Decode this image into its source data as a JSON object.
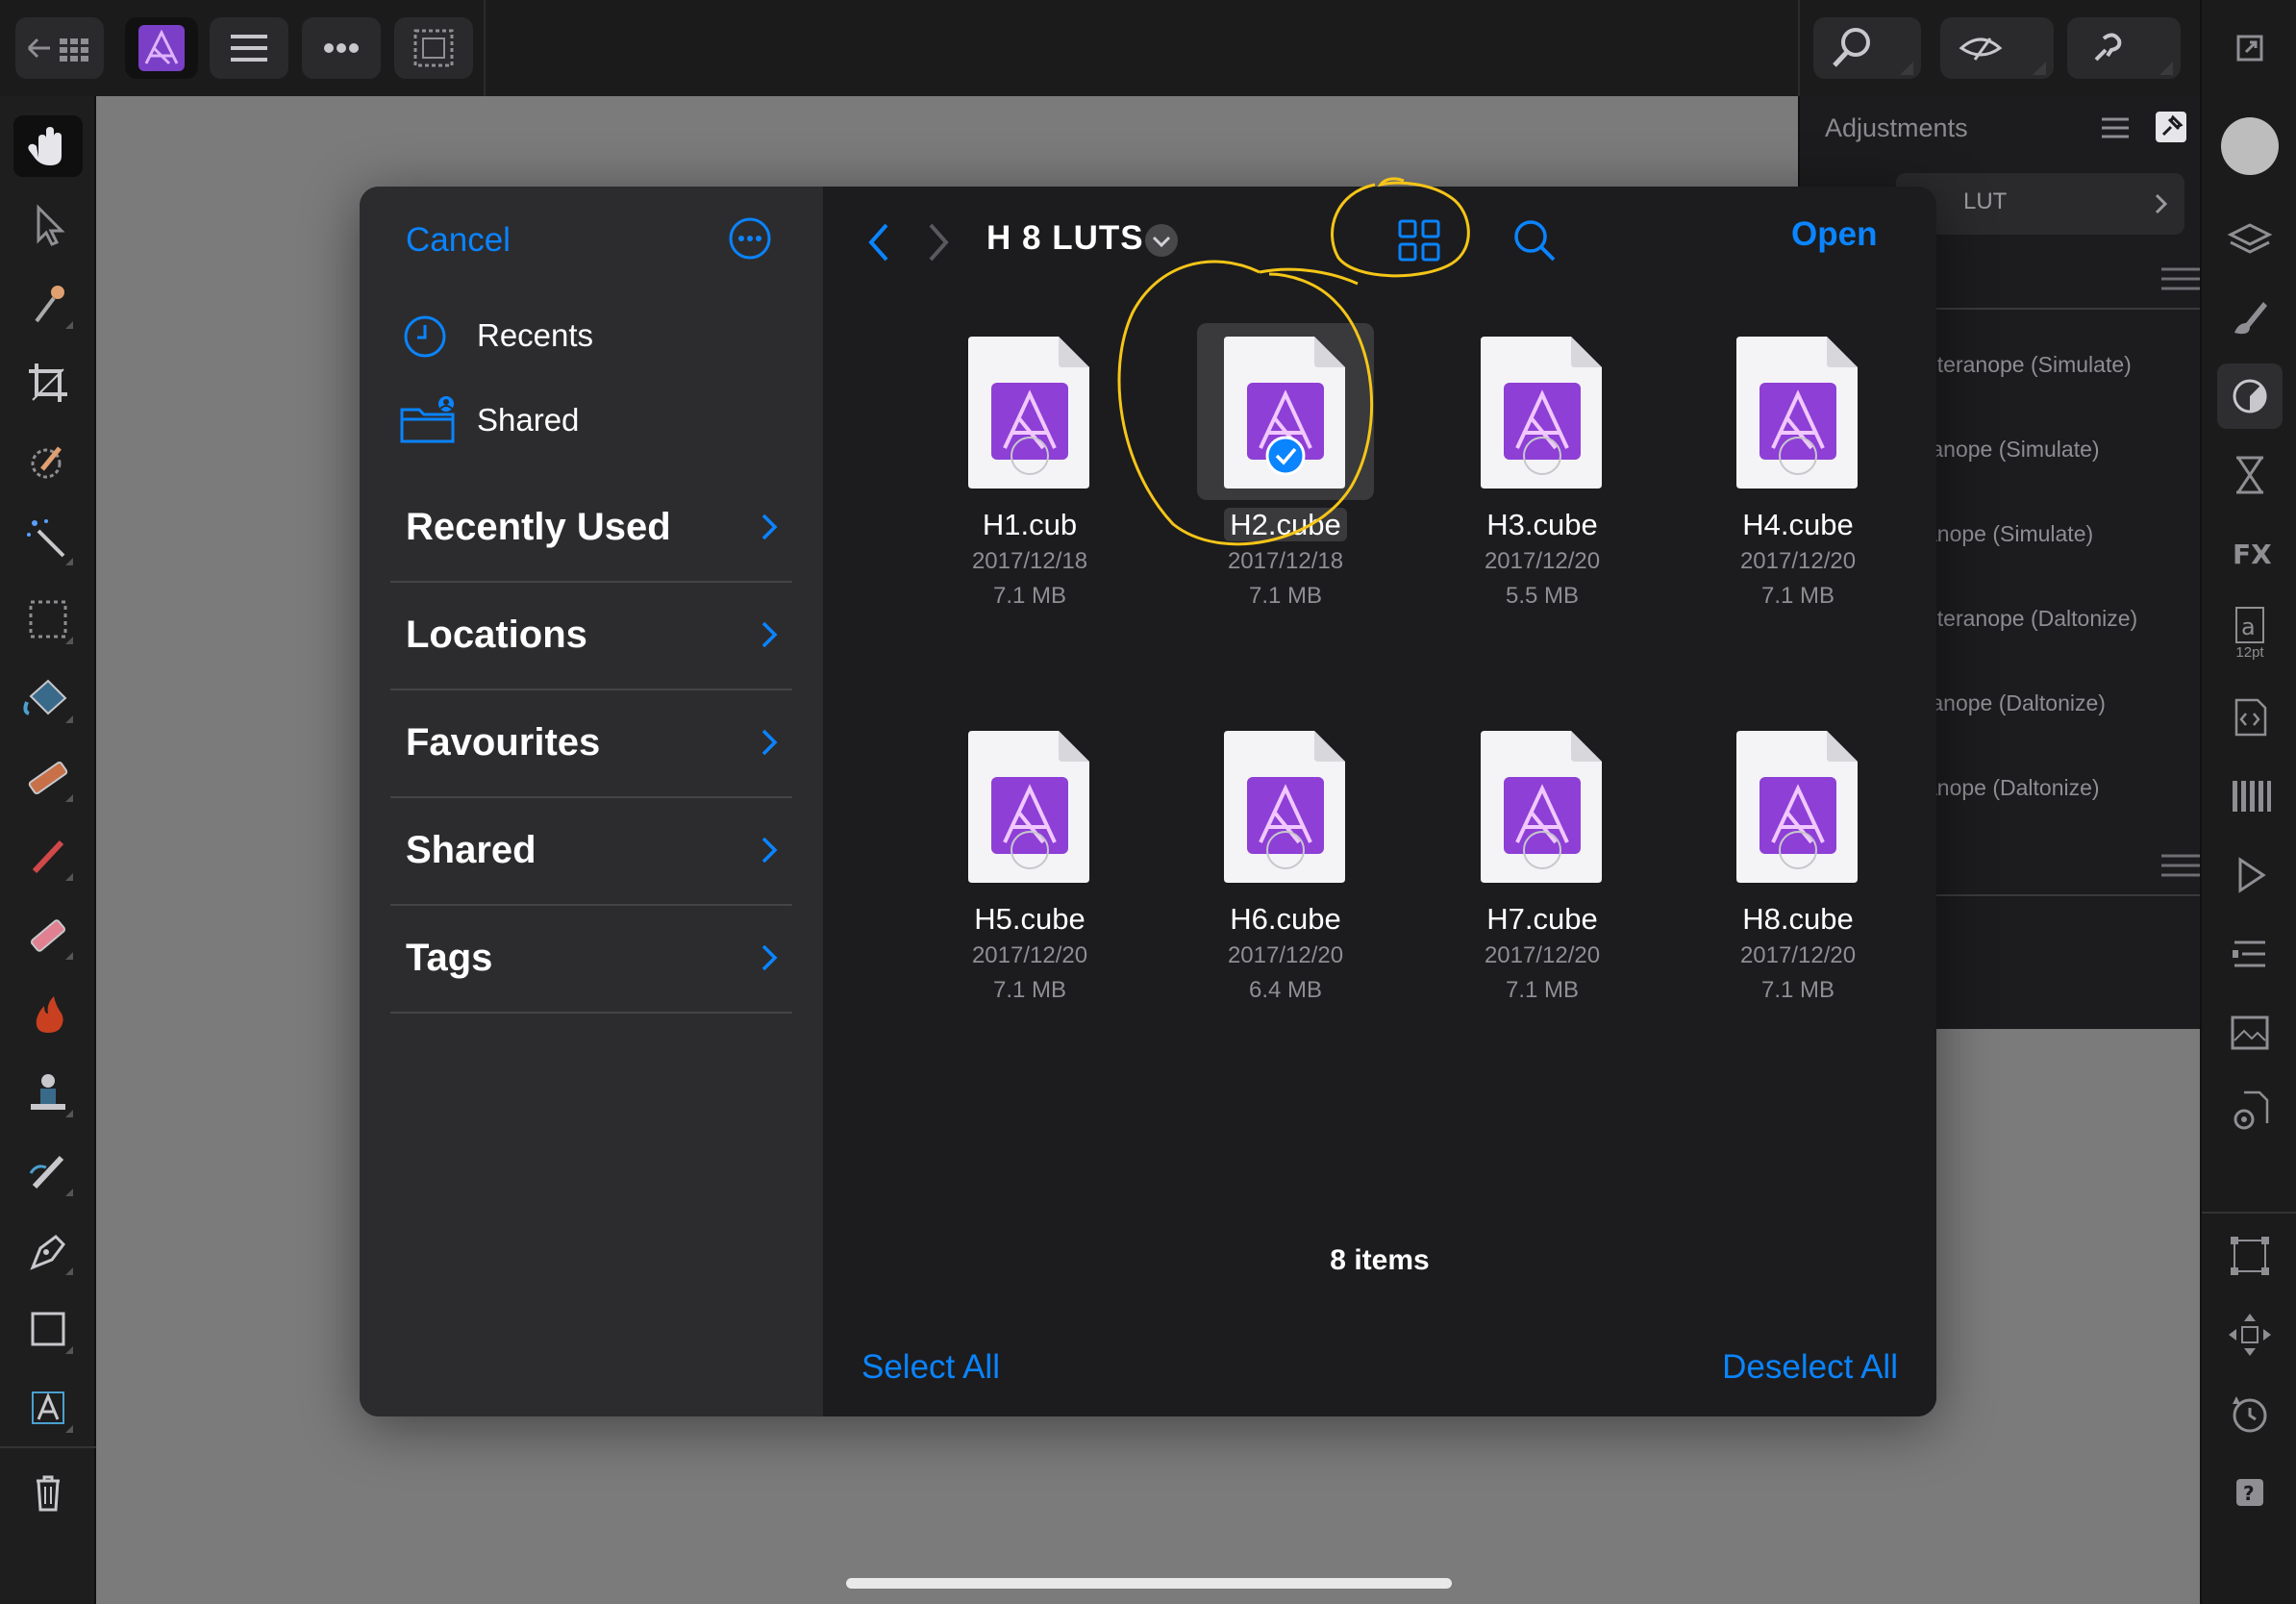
{
  "app": {
    "name": "Affinity Photo",
    "accent": "#0a84ff",
    "logo_purple": "#8e3fd6",
    "annotation_color": "#f5c518"
  },
  "topbar": {
    "left_icons": [
      "back-grid-icon",
      "affinity-logo-icon",
      "menu-icon",
      "more-icon",
      "selection-icon"
    ],
    "right_icons": [
      "search-zoom-icon",
      "view-icon",
      "assistant-icon",
      "expand-icon"
    ]
  },
  "left_tools": [
    "hand-icon",
    "move-icon",
    "color-picker-icon",
    "crop-icon",
    "selection-brush-icon",
    "magic-wand-icon",
    "marquee-icon",
    "flood-fill-icon",
    "gradient-icon",
    "paint-brush-icon",
    "erase-icon",
    "burn-icon",
    "clone-icon",
    "healing-icon",
    "pen-icon",
    "rectangle-icon",
    "text-icon",
    "trash-icon"
  ],
  "adjustments_panel": {
    "title": "Adjustments",
    "lut_label": "LUT",
    "items": [
      "uteranope (Simulate)",
      "tanope (Simulate)",
      "anope (Simulate)",
      "uteranope (Daltonize)",
      "tanope (Daltonize)",
      "anope (Daltonize)"
    ]
  },
  "right_tools": [
    "color-icon",
    "layers-icon",
    "brushes-icon",
    "adjustments-icon",
    "history-hourglass-icon",
    "fx-icon",
    "text-style-icon",
    "code-icon",
    "swatches-icon",
    "play-icon",
    "channels-icon",
    "stock-icon",
    "settings-icon",
    "transform-icon",
    "navigator-icon",
    "history-icon",
    "help-icon"
  ],
  "text_style_label": "12pt",
  "picker": {
    "cancel": "Cancel",
    "recents": "Recents",
    "shared_top": "Shared",
    "sections": [
      "Recently Used",
      "Locations",
      "Favourites",
      "Shared",
      "Tags"
    ],
    "folder": "H 8 LUTS",
    "open": "Open",
    "item_count": "8 items",
    "select_all": "Select All",
    "deselect_all": "Deselect All",
    "files": [
      {
        "name": "H1.cub",
        "date": "2017/12/18",
        "size": "7.1 MB",
        "selected": false
      },
      {
        "name": "H2.cube",
        "date": "2017/12/18",
        "size": "7.1 MB",
        "selected": true
      },
      {
        "name": "H3.cube",
        "date": "2017/12/20",
        "size": "5.5 MB",
        "selected": false
      },
      {
        "name": "H4.cube",
        "date": "2017/12/20",
        "size": "7.1 MB",
        "selected": false
      },
      {
        "name": "H5.cube",
        "date": "2017/12/20",
        "size": "7.1 MB",
        "selected": false
      },
      {
        "name": "H6.cube",
        "date": "2017/12/20",
        "size": "6.4 MB",
        "selected": false
      },
      {
        "name": "H7.cube",
        "date": "2017/12/20",
        "size": "7.1 MB",
        "selected": false
      },
      {
        "name": "H8.cube",
        "date": "2017/12/20",
        "size": "7.1 MB",
        "selected": false
      }
    ]
  }
}
